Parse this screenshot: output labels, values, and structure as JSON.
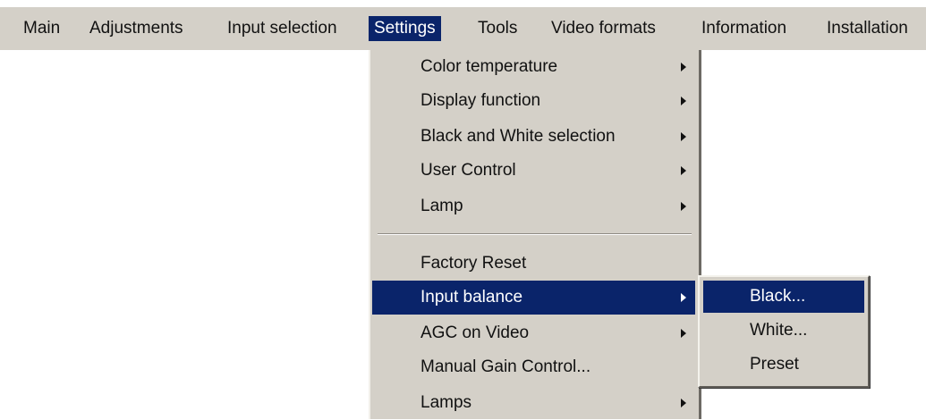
{
  "menubar": {
    "items": [
      {
        "label": "Main"
      },
      {
        "label": "Adjustments"
      },
      {
        "label": "Input selection"
      },
      {
        "label": "Settings"
      },
      {
        "label": "Tools"
      },
      {
        "label": "Video formats"
      },
      {
        "label": "Information"
      },
      {
        "label": "Installation"
      }
    ]
  },
  "settings_menu": {
    "items": [
      {
        "label": "Color temperature",
        "has_submenu": true
      },
      {
        "label": "Display function",
        "has_submenu": true
      },
      {
        "label": "Black and White selection",
        "has_submenu": true
      },
      {
        "label": "User Control",
        "has_submenu": true
      },
      {
        "label": "Lamp",
        "has_submenu": true
      },
      {
        "label": "Factory Reset",
        "has_submenu": false
      },
      {
        "label": "Input balance",
        "has_submenu": true
      },
      {
        "label": "AGC on Video",
        "has_submenu": true
      },
      {
        "label": "Manual Gain Control...",
        "has_submenu": false
      },
      {
        "label": "Lamps",
        "has_submenu": true
      }
    ]
  },
  "input_balance_submenu": {
    "items": [
      {
        "label": "Black..."
      },
      {
        "label": "White..."
      },
      {
        "label": "Preset"
      }
    ]
  },
  "colors": {
    "highlight": "#0a246a",
    "menu_background": "#d4d0c8"
  },
  "icons": {
    "submenu_indicator": "triangle-right-icon"
  }
}
